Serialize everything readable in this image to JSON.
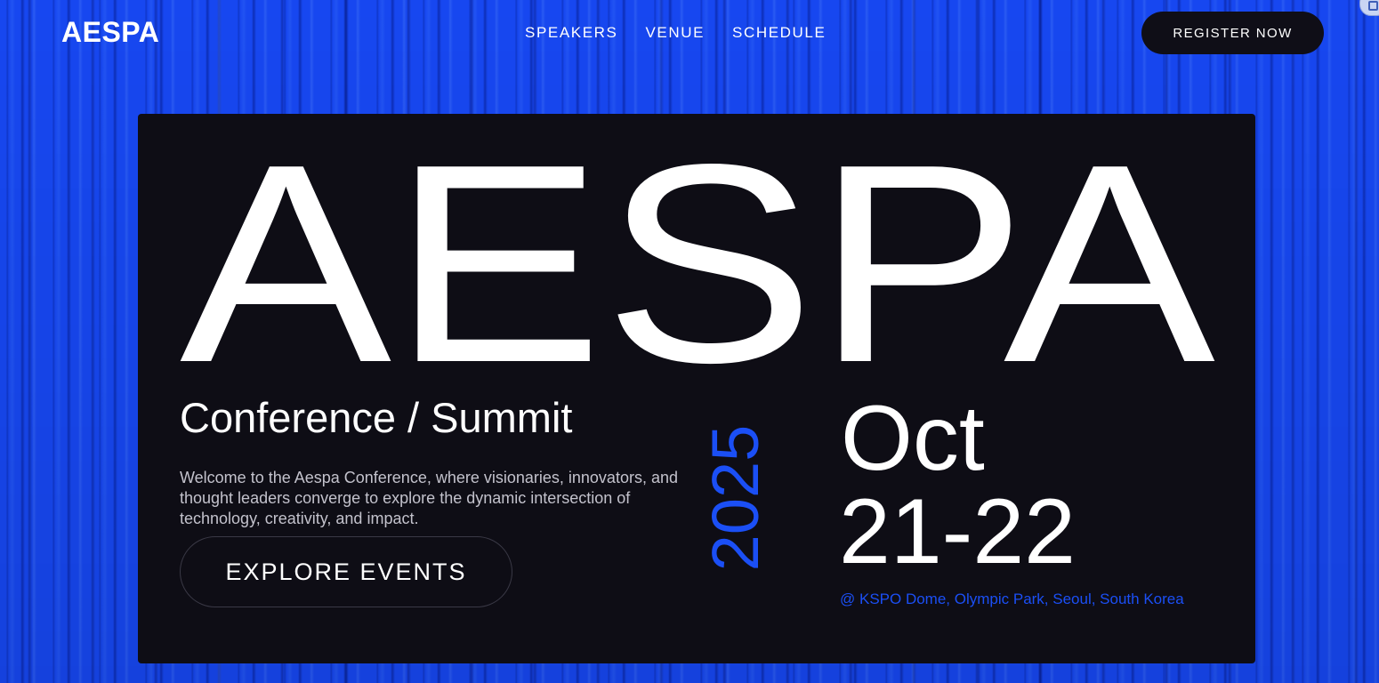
{
  "header": {
    "logo": "AESPA",
    "nav": [
      "SPEAKERS",
      "VENUE",
      "SCHEDULE"
    ],
    "register_label": "REGISTER NOW"
  },
  "hero": {
    "title": "AESPA",
    "subtitle": "Conference / Summit",
    "description": "Welcome to the Aespa Conference, where visionaries, innovators, and thought leaders converge to explore the dynamic intersection of technology, creativity, and impact.",
    "cta_label": "EXPLORE EVENTS",
    "year": "2025",
    "month": "Oct",
    "days": "21-22",
    "venue": "@ KSPO Dome, Olympic Park, Seoul, South Korea"
  },
  "colors": {
    "background_blue": "#1747f0",
    "card_dark": "#0e0d15",
    "accent_blue": "#1b4ff5",
    "text_white": "#ffffff",
    "text_muted": "#c3c2cc"
  }
}
